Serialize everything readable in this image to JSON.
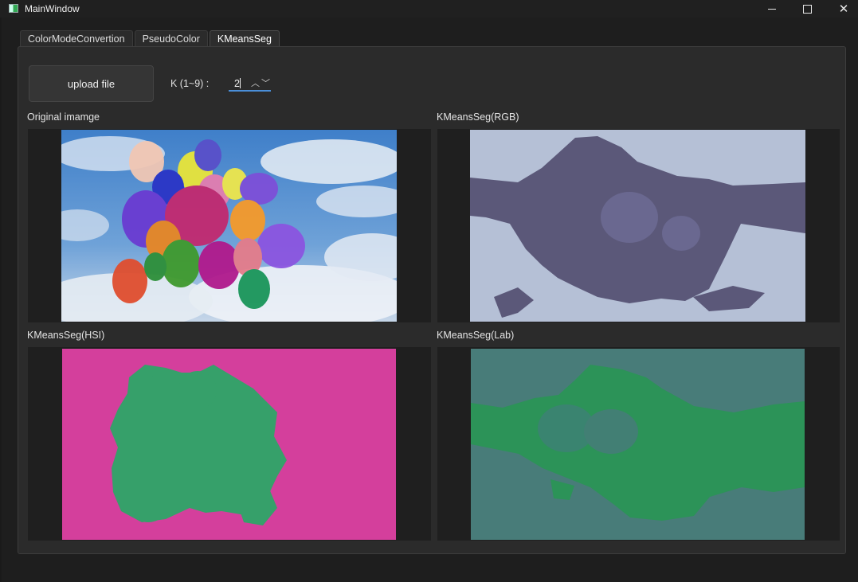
{
  "window": {
    "title": "MainWindow",
    "controls": {
      "minimize": "minimize",
      "maximize": "maximize",
      "close": "✕"
    }
  },
  "tabs": [
    {
      "label": "ColorModeConvertion",
      "active": false
    },
    {
      "label": "PseudoColor",
      "active": false
    },
    {
      "label": "KMeansSeg",
      "active": true
    }
  ],
  "toolbar": {
    "upload_label": "upload file",
    "k_label": "K (1~9) :",
    "k_value": "2",
    "up_arrow": "︿",
    "down_arrow": "﹀"
  },
  "panels": {
    "original": {
      "label": "Original imamge"
    },
    "rgb": {
      "label": "KMeansSeg(RGB)",
      "colors": [
        "#b5c0d6",
        "#5b5879"
      ]
    },
    "hsi": {
      "label": "KMeansSeg(HSI)",
      "colors": [
        "#d43f9c",
        "#36a06a"
      ]
    },
    "lab": {
      "label": "KMeansSeg(Lab)",
      "colors": [
        "#487c79",
        "#2c9358"
      ]
    }
  },
  "colors": {
    "background": "#1e1e1e",
    "panel": "#2b2b2b",
    "accent": "#4a8fd9"
  }
}
